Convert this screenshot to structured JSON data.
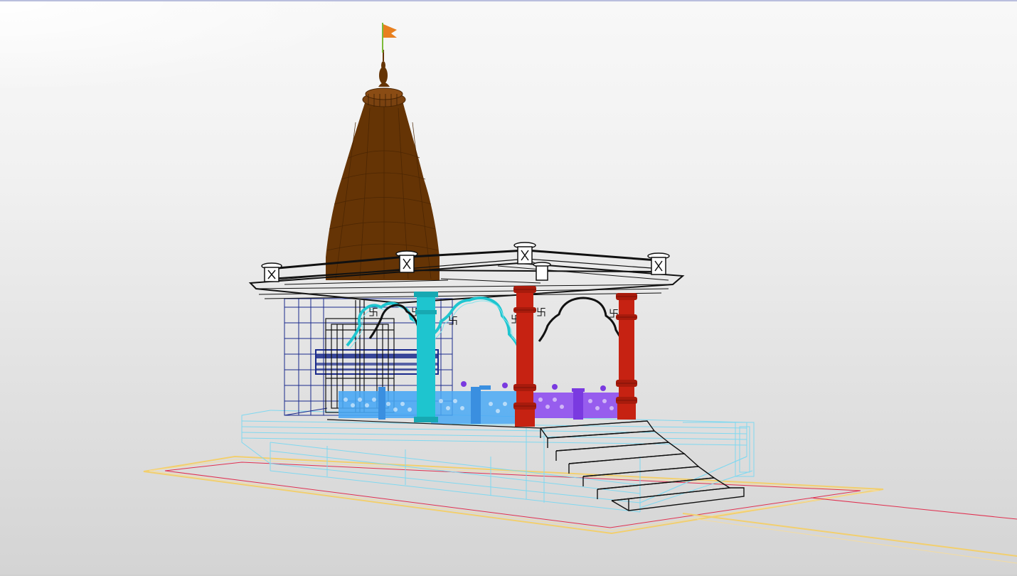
{
  "viewport": {
    "background_top": "#f8f8f8",
    "background_bottom": "#d4d4d4"
  },
  "model": {
    "shikhara_color": "#653405",
    "flag_color": "#e8801f",
    "wire_black": "#111111",
    "wire_cyan": "#7fd8f0",
    "column_teal": "#1ec5cf",
    "column_red": "#c62212",
    "railing_blue": "#4aa9f5",
    "railing_purple": "#8f4ff0",
    "lintel_navy": "#1a2a8c",
    "ground_red": "#e03050",
    "ground_yellow": "#f2cf6e"
  }
}
